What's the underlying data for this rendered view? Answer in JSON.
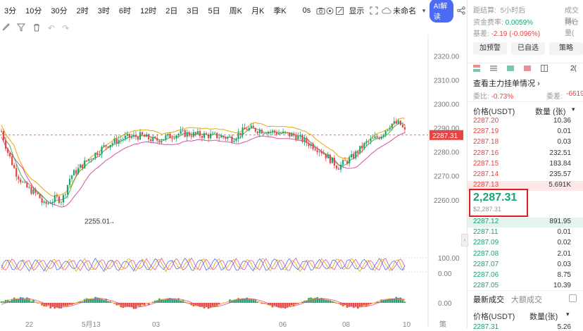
{
  "toolbar": {
    "timeframes": [
      "3分",
      "10分",
      "30分",
      "2时",
      "3时",
      "6时",
      "12时",
      "2日",
      "3日",
      "5日",
      "周K",
      "月K",
      "季K"
    ],
    "speed_label": "0s",
    "display_label": "显示",
    "layout_name": "未命名",
    "ai_label": "AI解读"
  },
  "chart_data": {
    "type": "candlestick",
    "y_ticks": [
      "2320.00",
      "2310.00",
      "2300.00",
      "2290.00",
      "2280.00",
      "2270.00",
      "2260.00"
    ],
    "ylim": [
      2252,
      2326
    ],
    "last_price_label": "2287.31",
    "last_price": 2287.31,
    "low_marker_label": "2255.01",
    "low_price": 2255.01,
    "indicator1_ticks": [
      "100.00",
      "0.00"
    ],
    "indicator2_ticks": [
      "0.00"
    ],
    "x_labels": [
      "22",
      "5月13",
      "03",
      "06",
      "08",
      "10"
    ],
    "x_right_label": "策"
  },
  "panel": {
    "settle_label": "距结算:",
    "settle_time": "5小时后",
    "vol_label": "成交额(",
    "funding_label": "资金费率:",
    "funding_value": "0.0059%",
    "position_label": "持仓量(",
    "basis_label": "基差:",
    "basis_value": "-2.19 (-0.096%)",
    "buttons": [
      "加预警",
      "已自选",
      "策略"
    ],
    "depth_count": "2(",
    "view_link": "查看主力挂单情况",
    "ratio_label": "委比:",
    "ratio_value": "-0.73%",
    "diff_label": "委差:",
    "diff_value": "-6619",
    "price_header": "价格(USDT)",
    "qty_header": "数量 (张)",
    "asks": [
      {
        "price": "2287.20",
        "qty": "10.36"
      },
      {
        "price": "2287.19",
        "qty": "0.01"
      },
      {
        "price": "2287.18",
        "qty": "0.03"
      },
      {
        "price": "2287.16",
        "qty": "232.51"
      },
      {
        "price": "2287.15",
        "qty": "183.84"
      },
      {
        "price": "2287.14",
        "qty": "235.57"
      },
      {
        "price": "2287.13",
        "qty": "5.691K"
      }
    ],
    "last_price": "2,287.31",
    "last_price_usd": "$2,287.31",
    "bids": [
      {
        "price": "2287.12",
        "qty": "891.95"
      },
      {
        "price": "2287.11",
        "qty": "0.01"
      },
      {
        "price": "2287.09",
        "qty": "0.02"
      },
      {
        "price": "2287.08",
        "qty": "2.01"
      },
      {
        "price": "2287.07",
        "qty": "0.03"
      },
      {
        "price": "2287.06",
        "qty": "8.75"
      },
      {
        "price": "2287.05",
        "qty": "10.39"
      }
    ],
    "trades_tab": "最新成交",
    "big_trades_tab": "大额成交",
    "trades_price_header": "价格(USDT)",
    "trades_qty_header": "数量(张)",
    "trade_first_price": "2287.31",
    "trade_first_qty": "5.26"
  },
  "colors": {
    "up": "#1aa37a",
    "down": "#e64545",
    "accent": "#4b6bf5",
    "highlight": "#e02020"
  }
}
